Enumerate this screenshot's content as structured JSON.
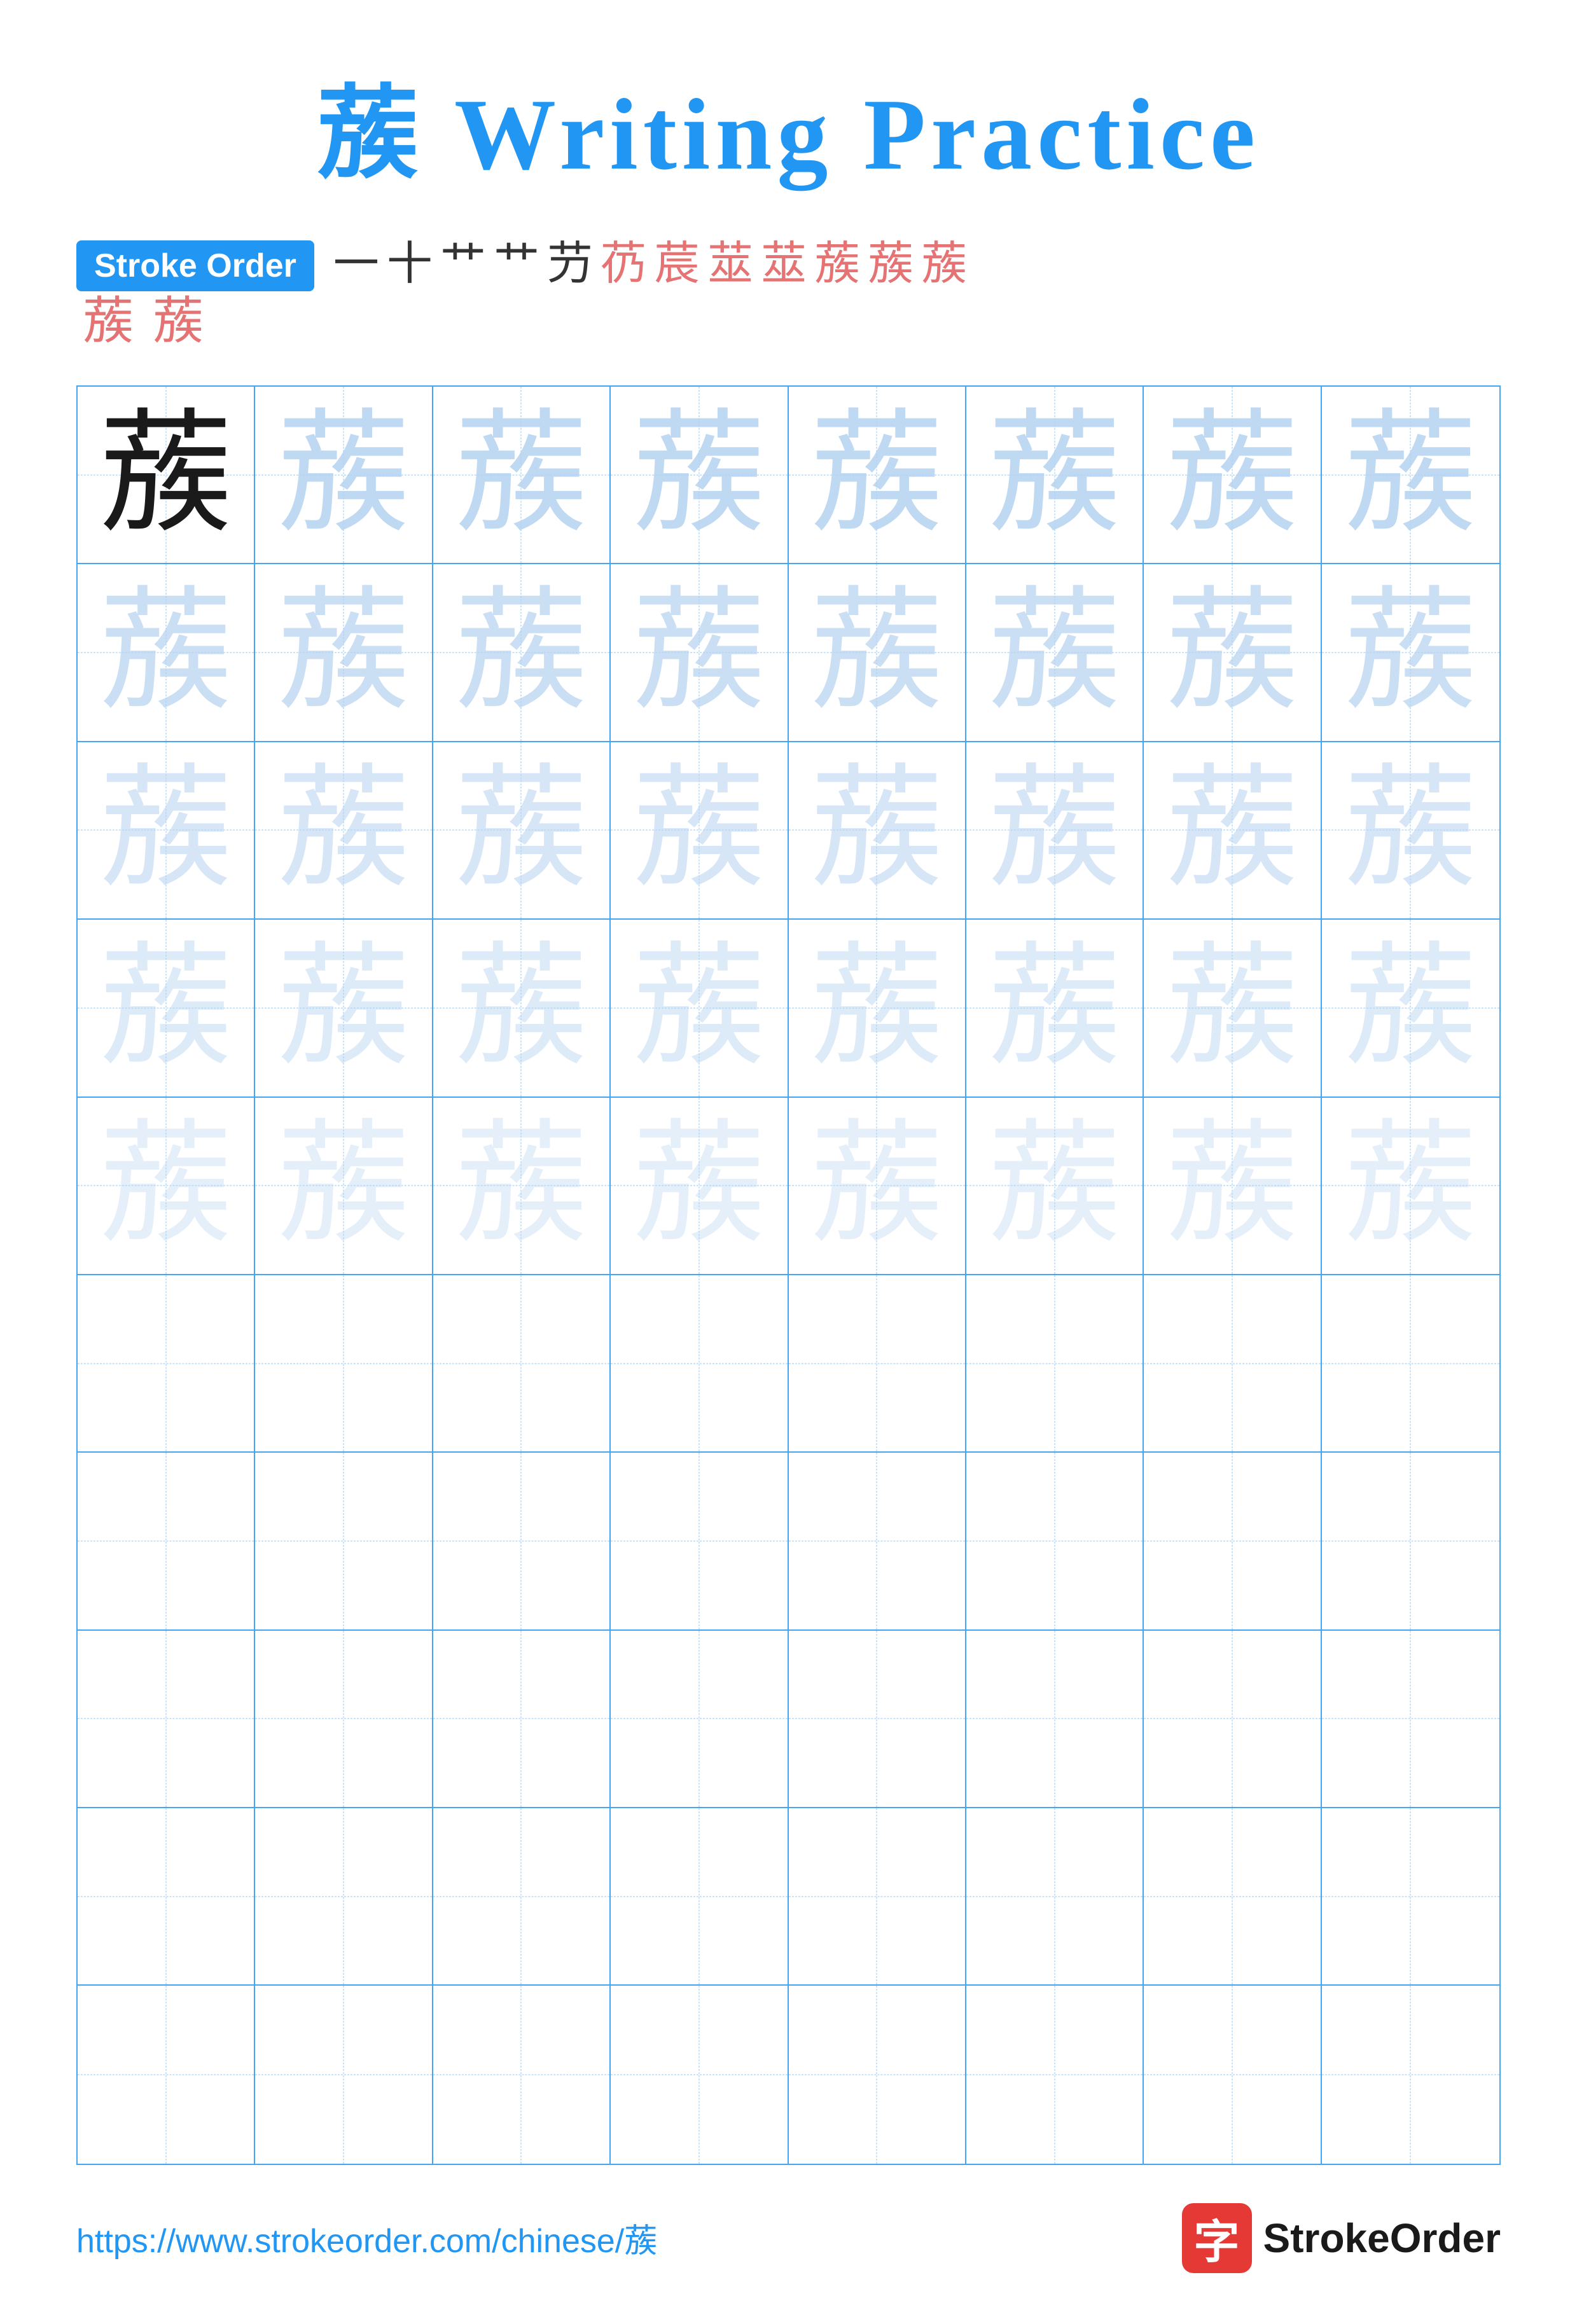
{
  "page": {
    "title": "蔟 Writing Practice",
    "title_char": "蔟",
    "title_suffix": " Writing Practice",
    "stroke_order_label": "Stroke Order",
    "stroke_sequence": [
      "一",
      "十",
      "艹",
      "艹",
      "芀",
      "芿",
      "莀",
      "莁",
      "莁",
      "蔟",
      "蔟",
      "蔟"
    ],
    "stroke_extra": [
      "蔟",
      "蔟"
    ],
    "practice_char": "蔟",
    "footer_url": "https://www.strokeorder.com/chinese/蔟",
    "brand_icon_char": "字",
    "brand_name": "StrokeOrder",
    "colors": {
      "accent": "#2196F3",
      "brand_red": "#e53935",
      "dark_text": "#1a1a1a",
      "light_char_1": "rgba(150,195,235,0.85)",
      "light_char_2": "rgba(150,195,235,0.70)",
      "light_char_3": "rgba(150,195,235,0.55)",
      "light_char_4": "rgba(150,195,235,0.42)",
      "light_char_5": "rgba(150,195,235,0.30)"
    },
    "grid": {
      "rows": 10,
      "cols": 8,
      "filled_rows": 5
    }
  }
}
